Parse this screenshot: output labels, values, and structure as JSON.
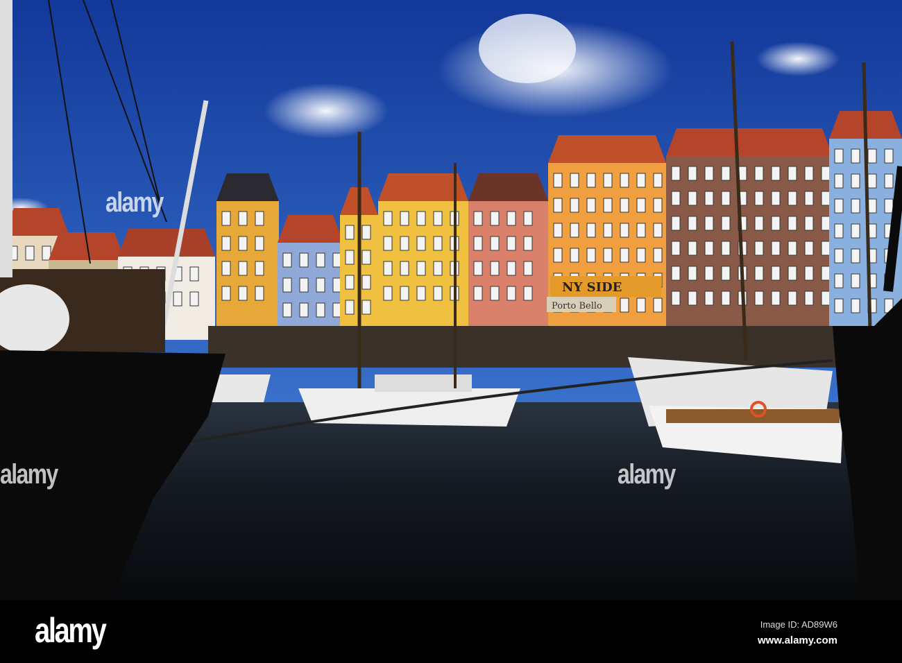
{
  "photo": {
    "signs": {
      "cafe_sign": "NY SIDE",
      "restaurant_awning": "Porto Bello"
    },
    "colors": {
      "sky": "#1f4fb0",
      "water": "#0d1116",
      "hull": "#0a0a0a"
    }
  },
  "watermarks": [
    "alamy",
    "alamy",
    "alamy"
  ],
  "footer": {
    "logo": "alamy",
    "image_id": "Image ID: AD89W6",
    "website": "www.alamy.com"
  }
}
